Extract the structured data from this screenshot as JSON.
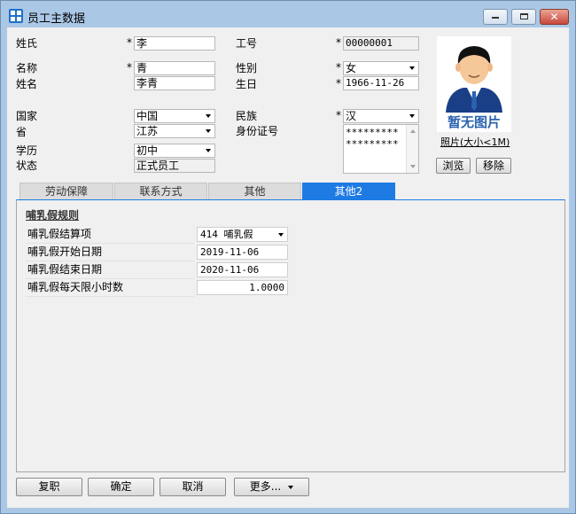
{
  "window": {
    "title": "员工主数据",
    "minimize_icon": "minimize-icon",
    "maximize_icon": "maximize-icon",
    "close_label": "✕"
  },
  "form": {
    "required_mark": "*",
    "last_name": {
      "label": "姓氏",
      "value": "李"
    },
    "first_name": {
      "label": "名称",
      "value": "青"
    },
    "full_name": {
      "label": "姓名",
      "value": "李青"
    },
    "employee_no": {
      "label": "工号",
      "value": "00000001"
    },
    "gender": {
      "label": "性别",
      "value": "女"
    },
    "birthday": {
      "label": "生日",
      "value": "1966-11-26"
    },
    "country": {
      "label": "国家",
      "value": "中国"
    },
    "province": {
      "label": "省",
      "value": "江苏"
    },
    "education": {
      "label": "学历",
      "value": "初中"
    },
    "status": {
      "label": "状态",
      "value": "正式员工"
    },
    "ethnicity": {
      "label": "民族",
      "value": "汉"
    },
    "id_number": {
      "label": "身份证号",
      "value": "******************"
    }
  },
  "photo": {
    "caption": "暂无图片",
    "link": "照片(大小<1M)",
    "browse_label": "浏览",
    "remove_label": "移除"
  },
  "tabs": [
    {
      "label": "劳动保障"
    },
    {
      "label": "联系方式"
    },
    {
      "label": "其他"
    },
    {
      "label": "其他2"
    }
  ],
  "active_tab_index": 3,
  "colors": {
    "accent": "#1e7be4",
    "titlebar": "#aac8e6",
    "photo_caption": "#2b63b0"
  },
  "panel": {
    "section_title": "哺乳假规则",
    "rows": [
      {
        "label": "哺乳假结算项",
        "value": "414 哺乳假",
        "type": "combo"
      },
      {
        "label": "哺乳假开始日期",
        "value": "2019-11-06",
        "type": "text"
      },
      {
        "label": "哺乳假结束日期",
        "value": "2020-11-06",
        "type": "text"
      },
      {
        "label": "哺乳假每天限小时数",
        "value": "1.0000",
        "type": "number"
      }
    ]
  },
  "footer": {
    "rehire_label": "复职",
    "ok_label": "确定",
    "cancel_label": "取消",
    "more_label": "更多..."
  }
}
